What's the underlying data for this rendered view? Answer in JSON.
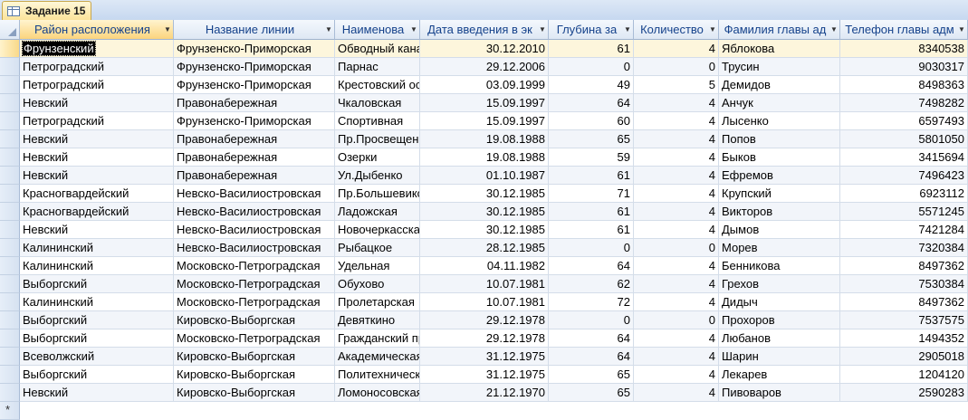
{
  "tab": {
    "title": "Задание 15"
  },
  "columns": [
    "Район расположения",
    "Название линии",
    "Наименова",
    "Дата введения  в эк",
    "Глубина за",
    "Количество",
    "Фамилия главы ад",
    "Телефон главы адм"
  ],
  "rows": [
    [
      "Фрунзенский",
      "Фрунзенско-Приморская",
      "Обводный канал",
      "30.12.2010",
      "61",
      "4",
      "Яблокова",
      "8340538"
    ],
    [
      "Петроградский",
      "Фрунзенско-Приморская",
      "Парнас",
      "29.12.2006",
      "0",
      "0",
      "Трусин",
      "9030317"
    ],
    [
      "Петроградский",
      "Фрунзенско-Приморская",
      "Крестовский остров",
      "03.09.1999",
      "49",
      "5",
      "Демидов",
      "8498363"
    ],
    [
      "Невский",
      "Правонабережная",
      "Чкаловская",
      "15.09.1997",
      "64",
      "4",
      "Анчук",
      "7498282"
    ],
    [
      "Петроградский",
      "Фрунзенско-Приморская",
      "Спортивная",
      "15.09.1997",
      "60",
      "4",
      "Лысенко",
      "6597493"
    ],
    [
      "Невский",
      "Правонабережная",
      "Пр.Просвещения",
      "19.08.1988",
      "65",
      "4",
      "Попов",
      "5801050"
    ],
    [
      "Невский",
      "Правонабережная",
      "Озерки",
      "19.08.1988",
      "59",
      "4",
      "Быков",
      "3415694"
    ],
    [
      "Невский",
      "Правонабережная",
      "Ул.Дыбенко",
      "01.10.1987",
      "61",
      "4",
      "Ефремов",
      "7496423"
    ],
    [
      "Красногвардейский",
      "Невско-Василиостровская",
      "Пр.Большевиков",
      "30.12.1985",
      "71",
      "4",
      "Крупский",
      "6923112"
    ],
    [
      "Красногвардейский",
      "Невско-Василиостровская",
      "Ладожская",
      "30.12.1985",
      "61",
      "4",
      "Викторов",
      "5571245"
    ],
    [
      "Невский",
      "Невско-Василиостровская",
      "Новочеркасская",
      "30.12.1985",
      "61",
      "4",
      "Дымов",
      "7421284"
    ],
    [
      "Калининский",
      "Невско-Василиостровская",
      "Рыбацкое",
      "28.12.1985",
      "0",
      "0",
      "Морев",
      "7320384"
    ],
    [
      "Калининский",
      "Московско-Петроградская",
      "Удельная",
      "04.11.1982",
      "64",
      "4",
      "Бенникова",
      "8497362"
    ],
    [
      "Выборгский",
      "Московско-Петроградская",
      "Обухово",
      "10.07.1981",
      "62",
      "4",
      "Грехов",
      "7530384"
    ],
    [
      "Калининский",
      "Московско-Петроградская",
      "Пролетарская",
      "10.07.1981",
      "72",
      "4",
      "Дидыч",
      "8497362"
    ],
    [
      "Выборгский",
      "Кировско-Выборгская",
      "Девяткино",
      "29.12.1978",
      "0",
      "0",
      "Прохоров",
      "7537575"
    ],
    [
      "Выборгский",
      "Московско-Петроградская",
      "Гражданский проспект",
      "29.12.1978",
      "64",
      "4",
      "Любанов",
      "1494352"
    ],
    [
      "Всеволжский",
      "Кировско-Выборгская",
      "Академическая",
      "31.12.1975",
      "64",
      "4",
      "Шарин",
      "2905018"
    ],
    [
      "Выборгский",
      "Кировско-Выборгская",
      "Политехническая",
      "31.12.1975",
      "65",
      "4",
      "Лекарев",
      "1204120"
    ],
    [
      "Невский",
      "Кировско-Выборгская",
      "Ломоносовская",
      "21.12.1970",
      "65",
      "4",
      "Пивоваров",
      "2590283"
    ]
  ],
  "new_row_marker": "*"
}
